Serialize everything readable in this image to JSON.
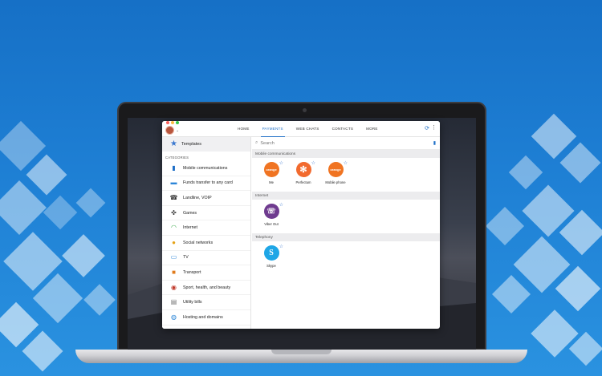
{
  "window": {
    "tabs": [
      "HOME",
      "PAYMENTS",
      "WEB CHATS",
      "CONTACTS",
      "MORE"
    ],
    "active_tab": "PAYMENTS"
  },
  "sidebar": {
    "templates_label": "Templates",
    "categories_header": "CATEGORIES",
    "items": [
      {
        "label": "Mobile communications",
        "icon": "mobile-phone-icon"
      },
      {
        "label": "Funds transfer to any card",
        "icon": "credit-card-icon"
      },
      {
        "label": "Landline, VOIP",
        "icon": "telephone-icon"
      },
      {
        "label": "Games",
        "icon": "gamepad-icon"
      },
      {
        "label": "Internet",
        "icon": "wifi-icon"
      },
      {
        "label": "Social networks",
        "icon": "people-icon"
      },
      {
        "label": "TV",
        "icon": "tv-icon"
      },
      {
        "label": "Transport",
        "icon": "bus-icon"
      },
      {
        "label": "Sport, health, and beauty",
        "icon": "balls-icon"
      },
      {
        "label": "Utility bills",
        "icon": "bill-icon"
      },
      {
        "label": "Hosting and domains",
        "icon": "globe-icon"
      }
    ]
  },
  "search": {
    "placeholder": "Search"
  },
  "sections": [
    {
      "title": "Mobile communications",
      "providers": [
        {
          "name": "Me",
          "logo_text": "orange",
          "color": "#f07422"
        },
        {
          "name": "Perfectum",
          "logo_text": "",
          "color": "#f26a2e"
        },
        {
          "name": "Mobile phone",
          "logo_text": "orange",
          "color": "#f07422"
        }
      ]
    },
    {
      "title": "Internet",
      "providers": [
        {
          "name": "Viber Out",
          "logo_text": "",
          "color": "#6f3b8f"
        }
      ]
    },
    {
      "title": "Telephony",
      "providers": [
        {
          "name": "Skype",
          "logo_text": "",
          "color": "#1ea6e6"
        }
      ]
    }
  ],
  "colors": {
    "accent": "#1e6fc7",
    "sidebar_selected": "#f0f0f2"
  }
}
